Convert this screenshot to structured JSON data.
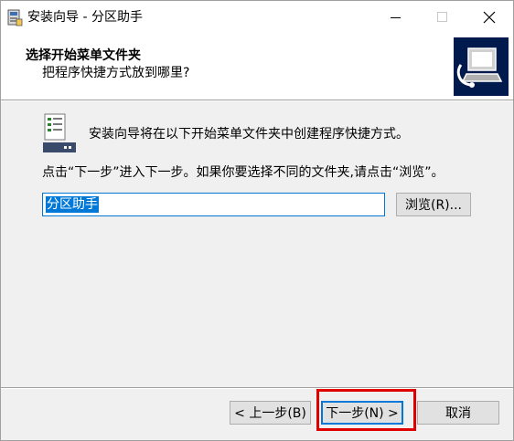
{
  "window": {
    "title": "安装向导 - 分区助手",
    "icons": {
      "app": "installer-icon",
      "minimize": "minimize-icon",
      "maximize": "maximize-icon",
      "close": "close-icon"
    }
  },
  "header": {
    "title": "选择开始菜单文件夹",
    "subtitle": "把程序快捷方式放到哪里?",
    "image_icon": "computer-install-icon"
  },
  "body": {
    "icon": "start-menu-folder-icon",
    "info": "安装向导将在以下开始菜单文件夹中创建程序快捷方式。",
    "instruction": "点击“下一步”进入下一步。如果你要选择不同的文件夹,请点击“浏览”。",
    "folder_value": "分区助手",
    "browse_label": "浏览(R)..."
  },
  "footer": {
    "back_label": "< 上一步(B)",
    "next_label": "下一步(N) >",
    "cancel_label": "取消",
    "highlight_color": "#e00000"
  },
  "colors": {
    "accent": "#0078d7",
    "window_bg": "#f0f0f0",
    "header_image_bg": "#001a4d"
  }
}
